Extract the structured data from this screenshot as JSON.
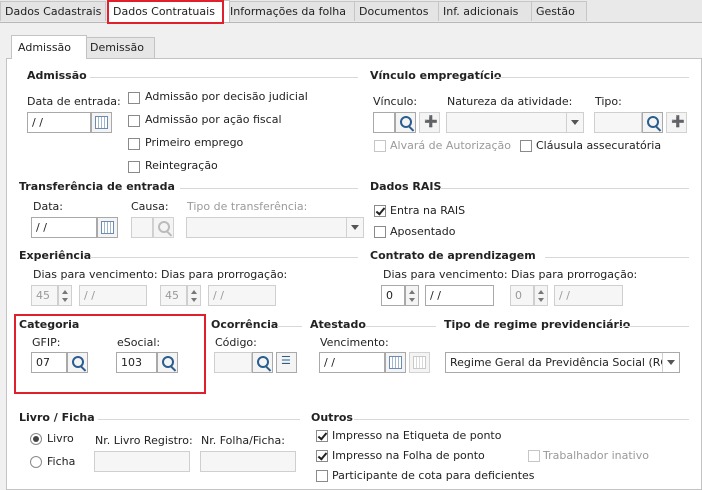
{
  "tabs": [
    "Dados Cadastrais",
    "Dados Contratuais",
    "Informações da folha",
    "Documentos",
    "Inf. adicionais",
    "Gestão"
  ],
  "subtabs": [
    "Admissão",
    "Demissão"
  ],
  "admissao": {
    "title": "Admissão",
    "data_entrada_label": "Data de entrada:",
    "data_entrada_value": " /  /",
    "checks": [
      "Admissão por decisão judicial",
      "Admissão por ação fiscal",
      "Primeiro emprego",
      "Reintegração"
    ]
  },
  "vinculo": {
    "title": "Vínculo empregatício",
    "vinculo_label": "Vínculo:",
    "natureza_label": "Natureza da atividade:",
    "tipo_label": "Tipo:",
    "alvara_label": "Alvará de Autorização",
    "clausula_label": "Cláusula assecuratória"
  },
  "transferencia": {
    "title": "Transferência de entrada",
    "data_label": "Data:",
    "data_value": " /  /",
    "causa_label": "Causa:",
    "tipo_label": "Tipo de transferência:"
  },
  "rais": {
    "title": "Dados RAIS",
    "entra_label": "Entra na RAIS",
    "aposentado_label": "Aposentado"
  },
  "experiencia": {
    "title": "Experiência",
    "venc_label": "Dias para vencimento:",
    "prorr_label": "Dias para prorrogação:",
    "venc_days": "45",
    "venc_date": " /  /",
    "prorr_days": "45",
    "prorr_date": " /  /"
  },
  "aprendizagem": {
    "title": "Contrato de aprendizagem",
    "venc_label": "Dias para vencimento:",
    "prorr_label": "Dias para prorrogação:",
    "venc_days": "0",
    "venc_date": " /  /",
    "prorr_days": "0",
    "prorr_date": " /  /"
  },
  "categoria": {
    "title": "Categoria",
    "gfip_label": "GFIP:",
    "gfip_value": "07",
    "esocial_label": "eSocial:",
    "esocial_value": "103"
  },
  "ocorrencia": {
    "title": "Ocorrência",
    "codigo_label": "Código:"
  },
  "atestado": {
    "title": "Atestado",
    "vencimento_label": "Vencimento:",
    "vencimento_value": " /  /"
  },
  "regime": {
    "title": "Tipo de regime previdenciário",
    "value": "Regime Geral da Previdência Social (RGPS)"
  },
  "livro": {
    "title": "Livro / Ficha",
    "livro_label": "Livro",
    "ficha_label": "Ficha",
    "nr_livro_label": "Nr. Livro Registro:",
    "nr_folha_label": "Nr. Folha/Ficha:"
  },
  "outros": {
    "title": "Outros",
    "impresso_etiqueta": "Impresso na Etiqueta de ponto",
    "impresso_folha": "Impresso na Folha de ponto",
    "trabalhador_inativo": "Trabalhador inativo",
    "participante": "Participante de cota para deficientes"
  }
}
